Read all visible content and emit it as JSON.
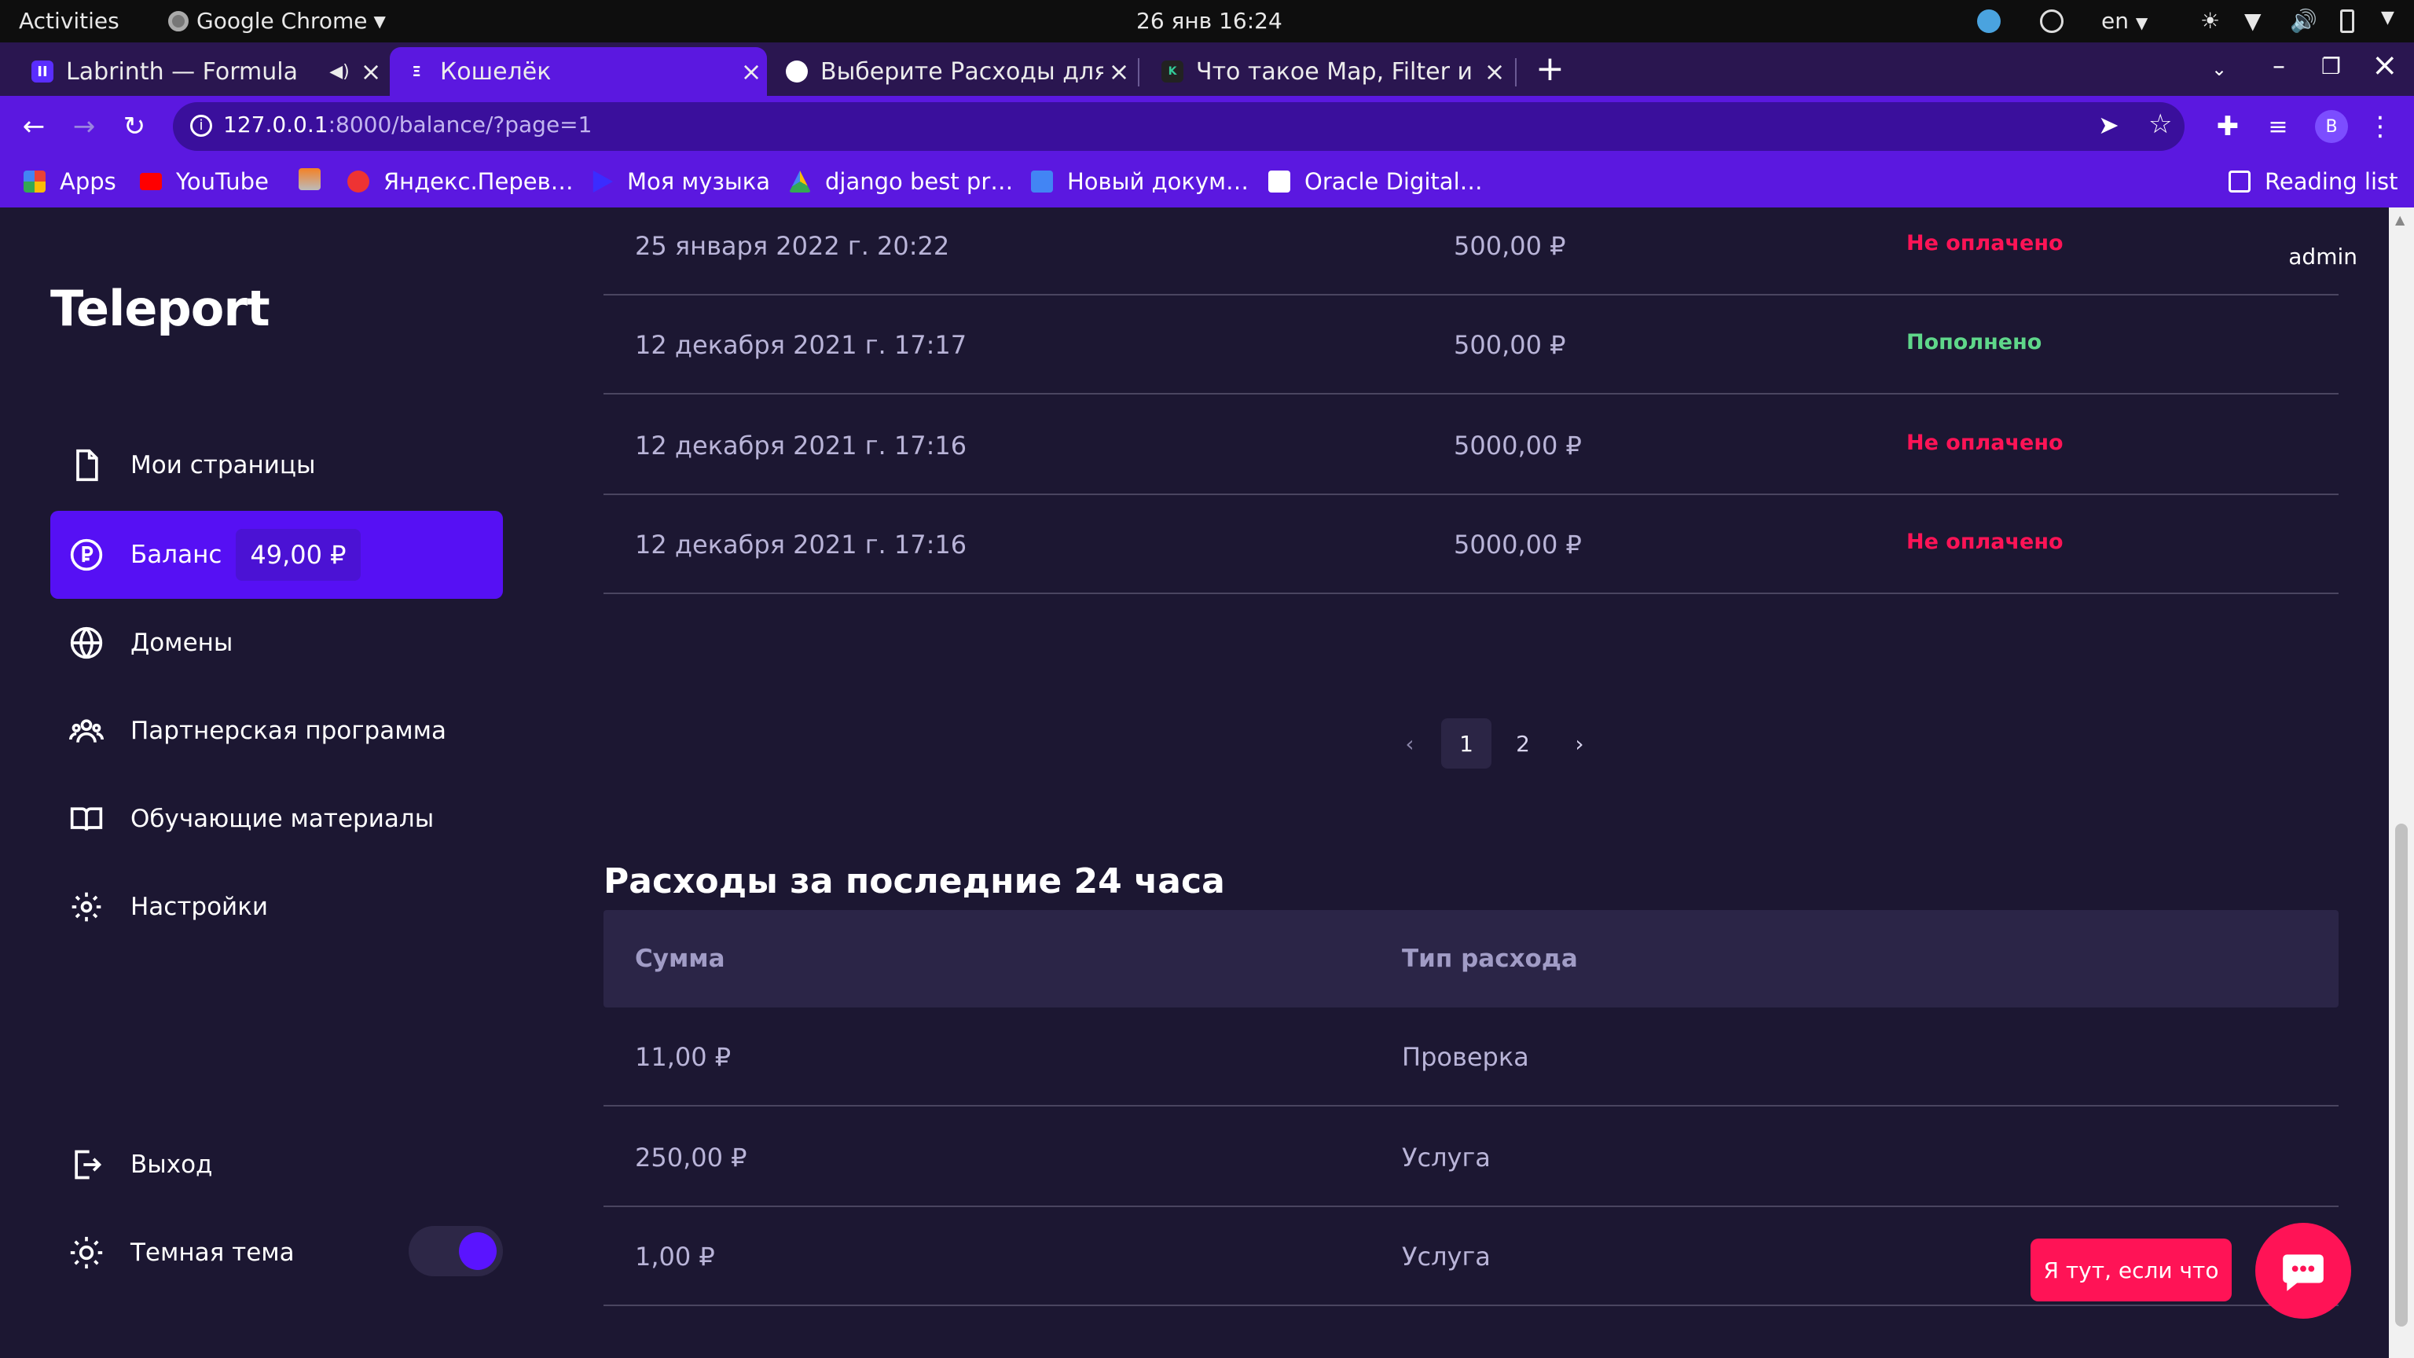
{
  "system": {
    "activities": "Activities",
    "app": "Google Chrome",
    "clock": "26 янв  16:24",
    "lang": "en"
  },
  "tabs": [
    {
      "title": "Labrinth — Formula"
    },
    {
      "title": "Кошелёк"
    },
    {
      "title": "Выберите Расходы для и"
    },
    {
      "title": "Что такое Map, Filter и Re"
    }
  ],
  "browser": {
    "url_host": "127.0.0.1",
    "url_rest": ":8000/balance/?page=1",
    "reading_list": "Reading list",
    "profile_initial": "B"
  },
  "bookmarks": [
    "Apps",
    "YouTube",
    "Яндекс.Перев…",
    "Моя музыка",
    "django best pr…",
    "Новый докум…",
    "Oracle Digital…"
  ],
  "app": {
    "logo": "Teleport",
    "user": "admin",
    "nav": {
      "pages": "Мои страницы",
      "balance": "Баланс",
      "balance_amount": "49,00 ₽",
      "domains": "Домены",
      "partner": "Партнерская программа",
      "learn": "Обучающие материалы",
      "settings": "Настройки",
      "logout": "Выход",
      "theme": "Темная тема"
    },
    "payments": [
      {
        "date": "25 января 2022 г. 20:22",
        "amount": "500,00 ₽",
        "status": "Не оплачено"
      },
      {
        "date": "12 декабря 2021 г. 17:17",
        "amount": "500,00 ₽",
        "status": "Пополнено"
      },
      {
        "date": "12 декабря 2021 г. 17:16",
        "amount": "5000,00 ₽",
        "status": "Не оплачено"
      },
      {
        "date": "12 декабря 2021 г. 17:16",
        "amount": "5000,00 ₽",
        "status": "Не оплачено"
      }
    ],
    "pagination": {
      "prev": "‹",
      "pages": [
        "1",
        "2"
      ],
      "next": "›"
    },
    "expenses": {
      "title": "Расходы за последние 24 часа",
      "headers": [
        "Сумма",
        "Тип расхода"
      ],
      "rows": [
        {
          "amount": "11,00 ₽",
          "type": "Проверка"
        },
        {
          "amount": "250,00 ₽",
          "type": "Услуга"
        },
        {
          "amount": "1,00 ₽",
          "type": "Услуга"
        }
      ]
    },
    "help_label": "Я тут, если что",
    "colors": {
      "accent": "#5610f4",
      "danger": "#ff1356",
      "success": "#5fd78a"
    }
  }
}
